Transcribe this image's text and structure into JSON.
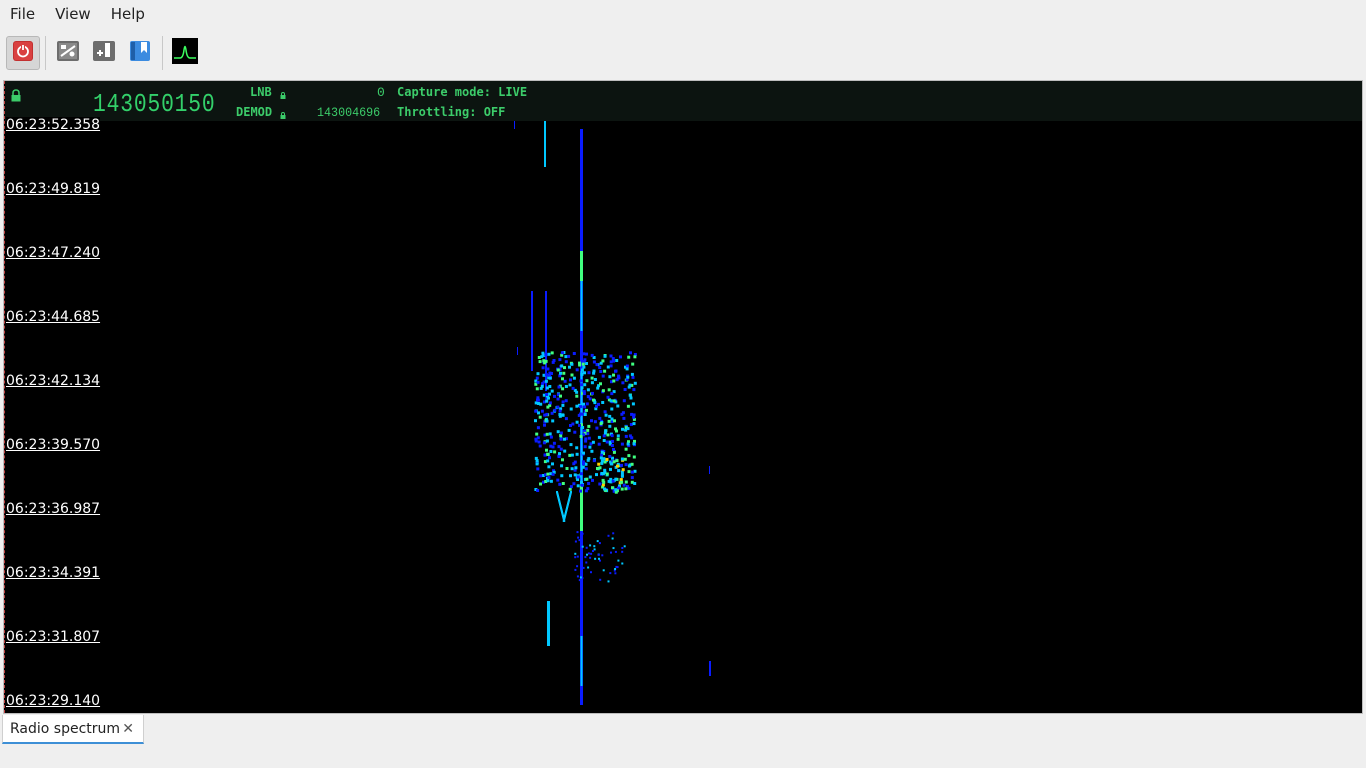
{
  "menu": {
    "file": "File",
    "view": "View",
    "help": "Help"
  },
  "toolbar": {
    "buttons": [
      {
        "name": "power",
        "icon": "power-icon",
        "pressed": true
      },
      {
        "name": "settings",
        "icon": "settings-panel-icon",
        "pressed": false
      },
      {
        "name": "add-bookmark",
        "icon": "add-bookmark-icon",
        "pressed": false
      },
      {
        "name": "bookmarks",
        "icon": "bookmark-book-icon",
        "pressed": false
      },
      {
        "name": "spectrum",
        "icon": "spectrum-icon",
        "pressed": false
      }
    ]
  },
  "header": {
    "main_frequency": "143050150",
    "lnb_label": "LNB",
    "lnb_value": "0",
    "demod_label": "DEMOD",
    "demod_value": "143004696",
    "capture_mode": "Capture mode: LIVE",
    "throttling": "Throttling: OFF"
  },
  "waterfall": {
    "timestamps": [
      "06:23:52.358",
      "06:23:49.819",
      "06:23:47.240",
      "06:23:44.685",
      "06:23:42.134",
      "06:23:39.570",
      "06:23:36.987",
      "06:23:34.391",
      "06:23:31.807",
      "06:23:29.140"
    ],
    "colors": {
      "background": "#000000",
      "low": "#0a1cff",
      "mid": "#00c8ff",
      "high": "#40ff80",
      "peak": "#ffd000"
    }
  },
  "tabs": [
    {
      "label": "Radio spectrum",
      "close_icon": "close-icon"
    }
  ]
}
